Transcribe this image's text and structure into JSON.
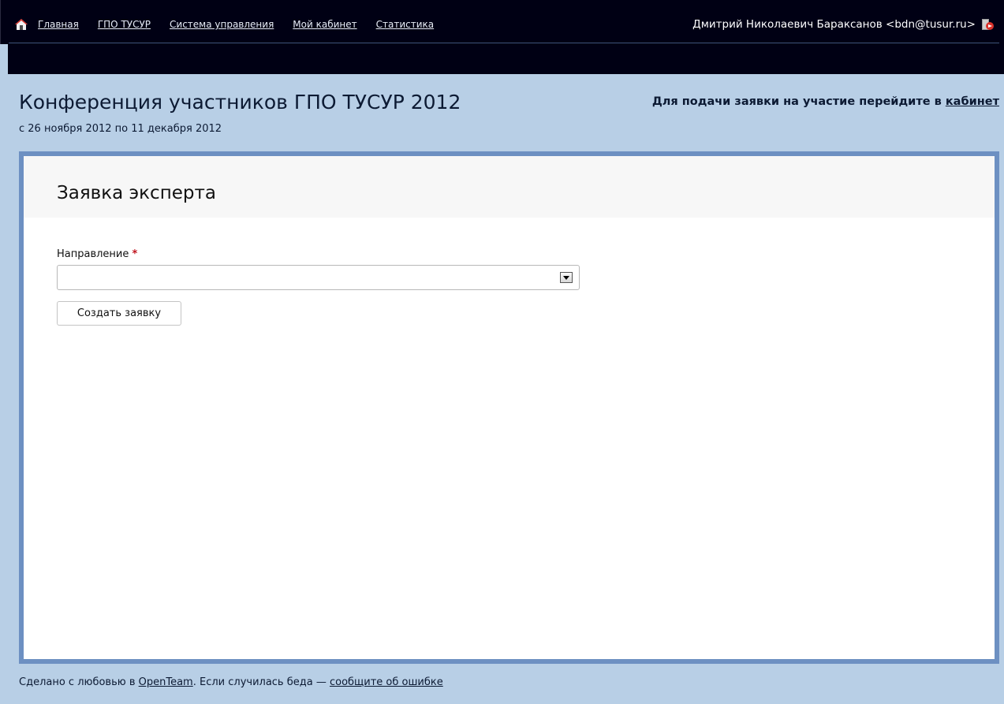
{
  "nav": {
    "home_icon": "home-icon",
    "links": [
      "Главная",
      "ГПО ТУСУР",
      "Система управления",
      "Мой кабинет",
      "Статистика"
    ]
  },
  "user": {
    "display": "Дмитрий Николаевич Бараксанов <bdn@tusur.ru>",
    "logout_icon": "logout-icon"
  },
  "header": {
    "title": "Конференция участников ГПО ТУСУР 2012",
    "dates": "с 26 ноября 2012 по 11 декабря 2012",
    "apply_hint_prefix": "Для подачи заявки на участие перейдите в ",
    "apply_hint_link": "кабинет"
  },
  "form": {
    "title": "Заявка эксперта",
    "field_label": "Направление",
    "required_mark": "*",
    "select_value": "",
    "submit_label": "Создать заявку"
  },
  "footer": {
    "text_before": "Сделано с любовью в ",
    "link_openteam": "OpenTeam",
    "text_middle": ". Если случилась беда — ",
    "link_report": "сообщите об ошибке"
  },
  "colors": {
    "topbar": "#000014",
    "background": "#b8cfe6",
    "panel_border": "#6d90c2",
    "required": "#c0141e"
  }
}
